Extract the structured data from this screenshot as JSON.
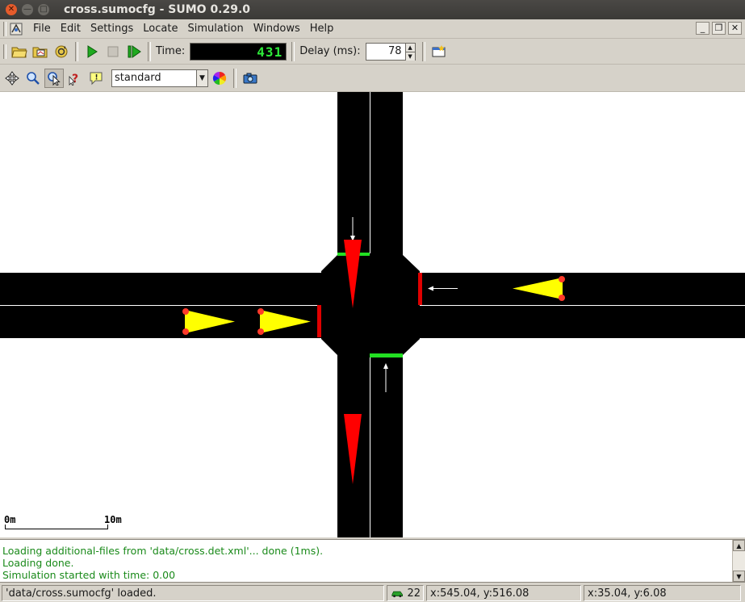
{
  "window": {
    "title": "cross.sumocfg - SUMO 0.29.0",
    "close_glyph": "✕",
    "min_glyph": "—",
    "max_glyph": "□"
  },
  "menu": {
    "items": [
      "File",
      "Edit",
      "Settings",
      "Locate",
      "Simulation",
      "Windows",
      "Help"
    ],
    "mdi_min": "_",
    "mdi_restore": "❐",
    "mdi_close": "✕"
  },
  "sim_toolbar": {
    "time_label": "Time:",
    "time_value": "431",
    "delay_label": "Delay (ms):",
    "delay_value": "78"
  },
  "view_toolbar": {
    "scheme_value": "standard"
  },
  "canvas": {
    "scale_start": "0m",
    "scale_end": "10m",
    "background": "#ffffff",
    "road_color": "#000000",
    "tls_red": "#e00000",
    "tls_green": "#22e022",
    "vehicle_yellow": "#ffff00",
    "vehicle_red": "#ff0000"
  },
  "log": {
    "lines": [
      "Loading additional-files from 'data/cross.det.xml'... done (1ms).",
      "Loading done.",
      "Simulation started with time: 0.00"
    ],
    "color": "#1a8a1a"
  },
  "status": {
    "message": "'data/cross.sumocfg' loaded.",
    "vehicle_count": "22",
    "cursor_pos": "x:545.04, y:516.08",
    "geo_pos": "x:35.04, y:6.08"
  }
}
